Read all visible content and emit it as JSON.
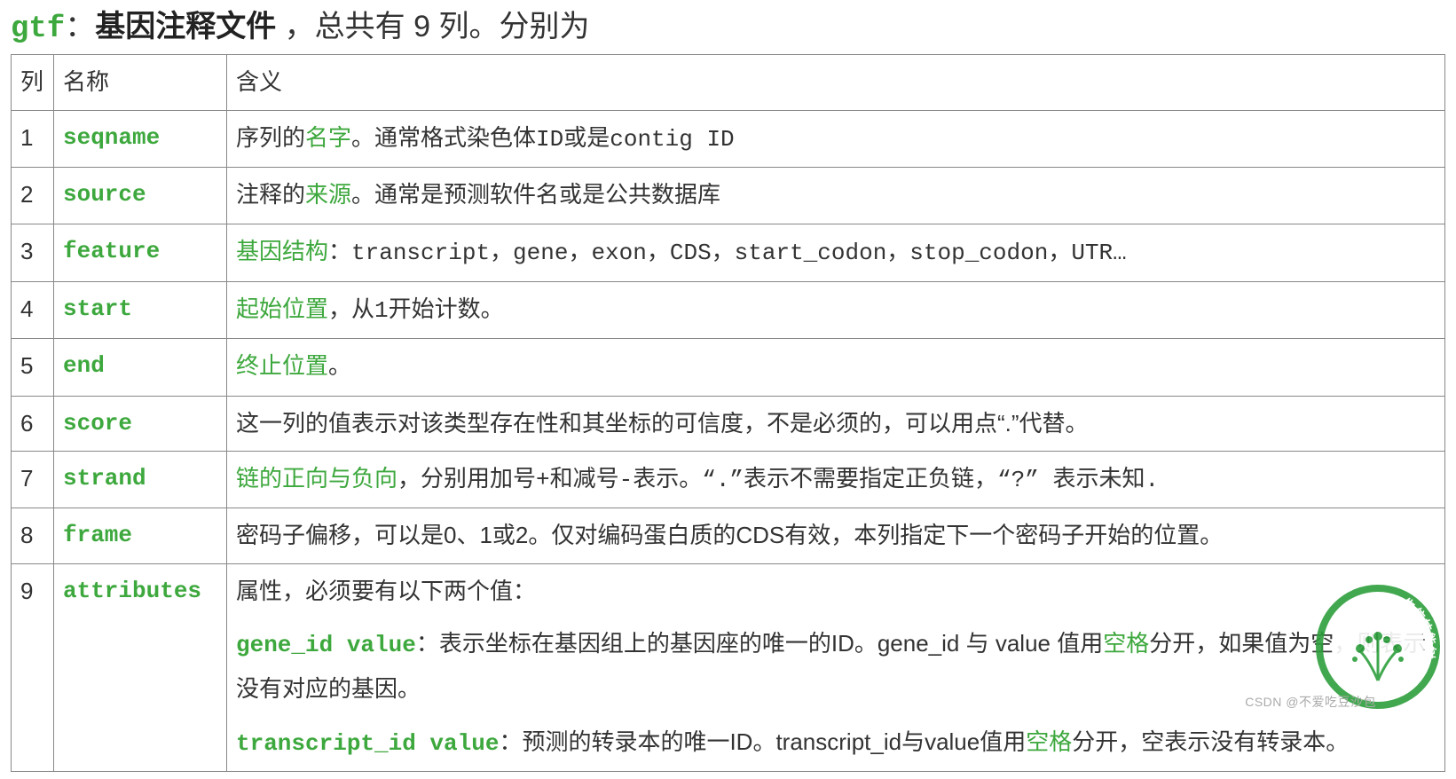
{
  "title": {
    "prefix": "gtf",
    "sep": "：",
    "bold": "基因注释文件",
    "rest": " ，总共有 9 列。分别为"
  },
  "headers": {
    "col": "列",
    "name": "名称",
    "meaning": "含义"
  },
  "rows": [
    {
      "n": "1",
      "name": "seqname",
      "m": {
        "pre": "序列的",
        "hl": "名字",
        "post": "。通常格式染色体ID或是contig ID"
      }
    },
    {
      "n": "2",
      "name": "source",
      "m": {
        "pre": "注释的",
        "hl": "来源",
        "post": "。通常是预测软件名或是公共数据库"
      }
    },
    {
      "n": "3",
      "name": "feature",
      "m": {
        "pre": "",
        "hl": "基因结构",
        "post": "：transcript，gene，exon，CDS，start_codon，stop_codon，UTR…"
      }
    },
    {
      "n": "4",
      "name": "start",
      "m": {
        "pre": "",
        "hl": "起始位置",
        "post": "，从1开始计数。"
      }
    },
    {
      "n": "5",
      "name": "end",
      "m": {
        "pre": "",
        "hl": "终止位置",
        "post": "。"
      }
    },
    {
      "n": "6",
      "name": "score",
      "m": {
        "plain": "这一列的值表示对该类型存在性和其坐标的可信度，不是必须的，可以用点“.”代替。"
      }
    },
    {
      "n": "7",
      "name": "strand",
      "m": {
        "pre": "",
        "hl": "链的正向与负向",
        "post": "，分别用加号+和减号-表示。“.”表示不需要指定正负链，“?” 表示未知."
      }
    },
    {
      "n": "8",
      "name": "frame",
      "m": {
        "plain": "密码子偏移，可以是0、1或2。仅对编码蛋白质的CDS有效，本列指定下一个密码子开始的位置。"
      }
    }
  ],
  "row9": {
    "n": "9",
    "name": "attributes",
    "intro": "属性，必须要有以下两个值：",
    "gene": {
      "key": "gene_id value",
      "t1": "：表示坐标在基因组上的基因座的唯一的ID。gene_id 与 value 值用",
      "hl": "空格",
      "t2": "分开，如果值为空，则表示没有对应的基因。"
    },
    "tx": {
      "key": "transcript_id value",
      "t1": "：预测的转录本的唯一ID。transcript_id与value值用",
      "hl": "空格",
      "t2": "分开，空表示没有转录本。"
    }
  },
  "watermark": "CSDN @不爱吃豆沙包",
  "logo_text": {
    "ring": "生信技能树"
  }
}
